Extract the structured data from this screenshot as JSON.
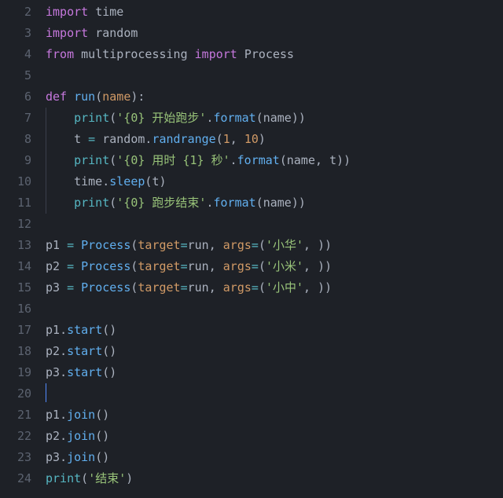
{
  "editor": {
    "first_line_number": 2,
    "last_line_number": 24,
    "cursor_line": 20,
    "lines": {
      "2": {
        "kw1": "import",
        "mod": "time"
      },
      "3": {
        "kw1": "import",
        "mod": "random"
      },
      "4": {
        "kw1": "from",
        "mod": "multiprocessing",
        "kw2": "import",
        "cls": "Process"
      },
      "5": {},
      "6": {
        "kw1": "def",
        "fn": "run",
        "p1": "name"
      },
      "7": {
        "fn": "print",
        "s1": "'{0} 开始跑步'",
        "m": "format",
        "a1": "name"
      },
      "8": {
        "v": "t",
        "mod": "random",
        "m": "randrange",
        "n1": "1",
        "n2": "10"
      },
      "9": {
        "fn": "print",
        "s1": "'{0} 用时 {1} 秒'",
        "m": "format",
        "a1": "name",
        "a2": "t"
      },
      "10": {
        "mod": "time",
        "m": "sleep",
        "a1": "t"
      },
      "11": {
        "fn": "print",
        "s1": "'{0} 跑步结束'",
        "m": "format",
        "a1": "name"
      },
      "12": {},
      "13": {
        "v": "p1",
        "cls": "Process",
        "kw_target": "target",
        "fn": "run",
        "kw_args": "args",
        "s": "'小华'"
      },
      "14": {
        "v": "p2",
        "cls": "Process",
        "kw_target": "target",
        "fn": "run",
        "kw_args": "args",
        "s": "'小米'"
      },
      "15": {
        "v": "p3",
        "cls": "Process",
        "kw_target": "target",
        "fn": "run",
        "kw_args": "args",
        "s": "'小中'"
      },
      "16": {},
      "17": {
        "v": "p1",
        "m": "start"
      },
      "18": {
        "v": "p2",
        "m": "start"
      },
      "19": {
        "v": "p3",
        "m": "start"
      },
      "20": {},
      "21": {
        "v": "p1",
        "m": "join"
      },
      "22": {
        "v": "p2",
        "m": "join"
      },
      "23": {
        "v": "p3",
        "m": "join"
      },
      "24": {
        "fn": "print",
        "s": "'结束'"
      }
    }
  }
}
